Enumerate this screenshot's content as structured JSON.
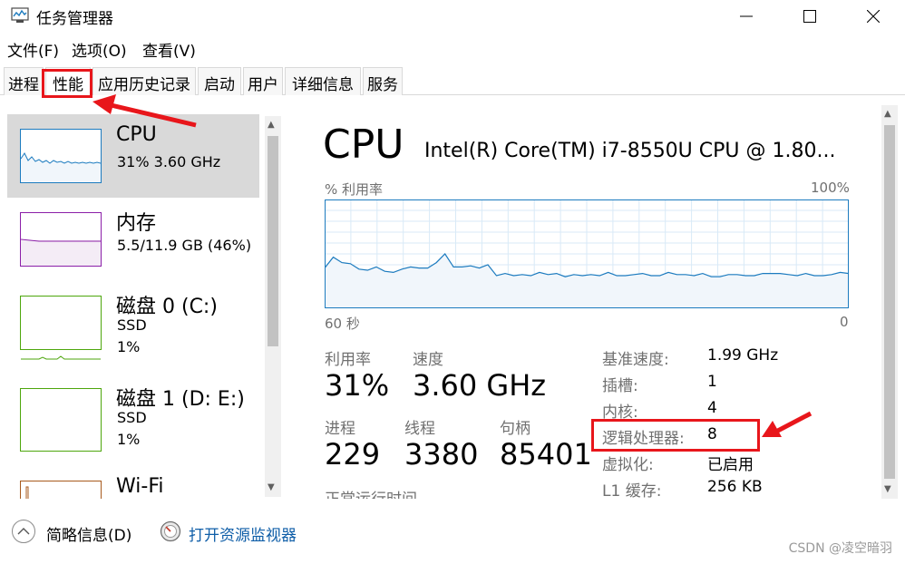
{
  "window": {
    "title": "任务管理器",
    "icon": "task-manager-icon"
  },
  "menu": [
    "文件(F)",
    "选项(O)",
    "查看(V)"
  ],
  "tabs": [
    "进程",
    "性能",
    "应用历史记录",
    "启动",
    "用户",
    "详细信息",
    "服务"
  ],
  "active_tab": "性能",
  "sidebar": [
    {
      "title": "CPU",
      "line1": "31%  3.60 GHz",
      "line2": "",
      "color": "#1c7bbf"
    },
    {
      "title": "内存",
      "line1": "5.5/11.9 GB (46%)",
      "line2": "",
      "color": "#8b1fa8"
    },
    {
      "title": "磁盘 0 (C:)",
      "line1": "SSD",
      "line2": "1%",
      "color": "#4da60c"
    },
    {
      "title": "磁盘 1 (D: E:)",
      "line1": "SSD",
      "line2": "1%",
      "color": "#4da60c"
    },
    {
      "title": "Wi-Fi",
      "line1": "",
      "line2": "",
      "color": "#a75a1d"
    }
  ],
  "main": {
    "title": "CPU",
    "model": "Intel(R) Core(TM) i7-8550U CPU @ 1.80...",
    "graph_label_left": "% 利用率",
    "graph_label_right": "100%",
    "time_left": "60 秒",
    "time_right": "0",
    "utilization_history": [
      0.37,
      0.47,
      0.42,
      0.41,
      0.36,
      0.35,
      0.38,
      0.34,
      0.33,
      0.36,
      0.38,
      0.37,
      0.37,
      0.42,
      0.5,
      0.38,
      0.38,
      0.39,
      0.37,
      0.4,
      0.3,
      0.32,
      0.3,
      0.31,
      0.3,
      0.33,
      0.31,
      0.32,
      0.29,
      0.31,
      0.3,
      0.31,
      0.3,
      0.33,
      0.3,
      0.3,
      0.31,
      0.32,
      0.3,
      0.3,
      0.33,
      0.31,
      0.31,
      0.3,
      0.32,
      0.29,
      0.29,
      0.31,
      0.31,
      0.3,
      0.3,
      0.32,
      0.32,
      0.32,
      0.31,
      0.3,
      0.32,
      0.3,
      0.3,
      0.31,
      0.33,
      0.32
    ],
    "stats": {
      "utilization_label": "利用率",
      "utilization": "31%",
      "speed_label": "速度",
      "speed": "3.60 GHz",
      "processes_label": "进程",
      "processes": "229",
      "threads_label": "线程",
      "threads": "3380",
      "handles_label": "句柄",
      "handles": "85401",
      "uptime_label": "正常运行时间"
    },
    "info": [
      {
        "label": "基准速度:",
        "value": "1.99 GHz"
      },
      {
        "label": "插槽:",
        "value": "1"
      },
      {
        "label": "内核:",
        "value": "4"
      },
      {
        "label": "逻辑处理器:",
        "value": "8"
      },
      {
        "label": "虚拟化:",
        "value": "已启用"
      },
      {
        "label": "L1 缓存:",
        "value": "256 KB"
      }
    ]
  },
  "footer": {
    "fewer_details": "简略信息(D)",
    "open_monitor": "打开资源监视器"
  },
  "watermark": "CSDN @凌空暗羽",
  "colors": {
    "cpu_line": "#1c7bbf",
    "cpu_fill": "#f1f6fb",
    "grid": "#d9eaf7",
    "annotation": "#e8161b",
    "link": "#0f5ea8"
  }
}
